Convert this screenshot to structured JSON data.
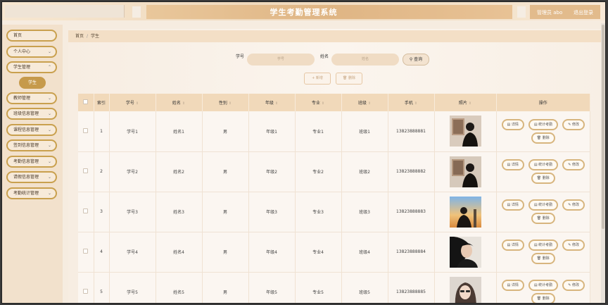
{
  "app": {
    "title": "学生考勤管理系统",
    "user_label": "管理员 abo",
    "logout_label": "退出登录"
  },
  "sidebar": {
    "items": [
      {
        "label": "首页",
        "chevron": false
      },
      {
        "label": "个人中心",
        "chevron": true
      },
      {
        "label": "学生管理",
        "chevron": true
      },
      {
        "label": "教师管理",
        "chevron": true
      },
      {
        "label": "班级信息管理",
        "chevron": true
      },
      {
        "label": "课程信息管理",
        "chevron": true
      },
      {
        "label": "签到信息管理",
        "chevron": true
      },
      {
        "label": "考勤信息管理",
        "chevron": true
      },
      {
        "label": "请假信息管理",
        "chevron": true
      },
      {
        "label": "考勤统计管理",
        "chevron": true
      }
    ],
    "sub_item": "学生"
  },
  "breadcrumb": {
    "home": "首页",
    "sep": "/",
    "current": "学生"
  },
  "search": {
    "student_no_label": "学号",
    "student_no_placeholder": "学号",
    "name_label": "姓名",
    "name_placeholder": "姓名",
    "query_button": "查询"
  },
  "actions": {
    "add": "新增",
    "delete": "删除"
  },
  "table": {
    "headers": [
      "索引",
      "学号",
      "姓名",
      "性别",
      "年级",
      "专业",
      "班级",
      "手机",
      "照片",
      "操作"
    ],
    "rows": [
      {
        "index": "1",
        "student_no": "学号1",
        "name": "姓名1",
        "gender": "男",
        "grade": "年级1",
        "major": "专业1",
        "class": "班级1",
        "phone": "13823888881",
        "photo": "photo-1"
      },
      {
        "index": "2",
        "student_no": "学号2",
        "name": "姓名2",
        "gender": "男",
        "grade": "年级2",
        "major": "专业2",
        "class": "班级2",
        "phone": "13823888882",
        "photo": "photo-2"
      },
      {
        "index": "3",
        "student_no": "学号3",
        "name": "姓名3",
        "gender": "男",
        "grade": "年级3",
        "major": "专业3",
        "class": "班级3",
        "phone": "13823888883",
        "photo": "photo-3"
      },
      {
        "index": "4",
        "student_no": "学号4",
        "name": "姓名4",
        "gender": "男",
        "grade": "年级4",
        "major": "专业4",
        "class": "班级4",
        "phone": "13823888884",
        "photo": "photo-4"
      },
      {
        "index": "5",
        "student_no": "学号5",
        "name": "姓名5",
        "gender": "男",
        "grade": "年级5",
        "major": "专业5",
        "class": "班级5",
        "phone": "13823888885",
        "photo": "photo-5"
      }
    ],
    "row_ops": {
      "detail": "详情",
      "stats": "统计考勤",
      "edit": "修改",
      "delete": "删除"
    }
  },
  "colors": {
    "accent": "#c69a4b",
    "header_bg": "#f1d9ba",
    "title_band": "#dfb584"
  }
}
